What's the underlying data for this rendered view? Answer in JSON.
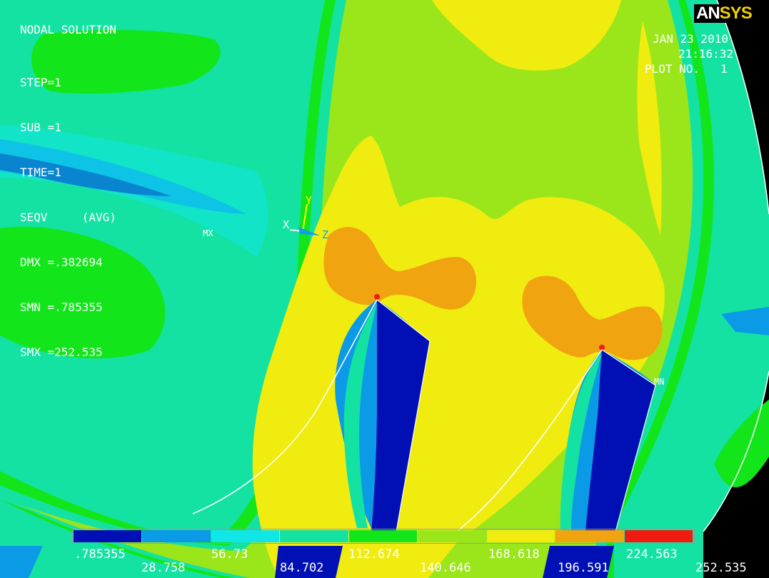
{
  "logo": {
    "part1": "AN",
    "part2": "SYS"
  },
  "info": {
    "title": "NODAL SOLUTION",
    "lines": [
      "STEP=1",
      "SUB =1",
      "TIME=1",
      "SEQV     (AVG)",
      "DMX =.382694",
      "SMN =.785355",
      "SMX =252.535"
    ]
  },
  "header": {
    "date": "JAN 23 2010",
    "time": "21:16:32",
    "plot_no": "PLOT NO.   1"
  },
  "markers": {
    "max": "MX",
    "min": "MN"
  },
  "triad": {
    "x": "X",
    "y": "Y",
    "z": "Z"
  },
  "legend": {
    "colors": [
      "#0010b4",
      "#0b9ae6",
      "#11e6e6",
      "#14e2a3",
      "#12e61a",
      "#9ae61a",
      "#f0ec10",
      "#f0a410",
      "#f01a10"
    ],
    "labels_top": [
      ".785355",
      "56.73",
      "112.674",
      "168.618",
      "224.563"
    ],
    "labels_bottom": [
      "28.758",
      "84.702",
      "140.646",
      "196.591",
      "252.535"
    ]
  },
  "colors": {
    "teal": "#14e2a3",
    "green": "#12e61a",
    "lime": "#9ae61a",
    "yellow": "#f0ec10",
    "orange": "#f0a410",
    "red": "#f01a10",
    "darkblue": "#0010b4",
    "skyblue": "#0b9ae6",
    "cyan": "#11e6e6"
  }
}
